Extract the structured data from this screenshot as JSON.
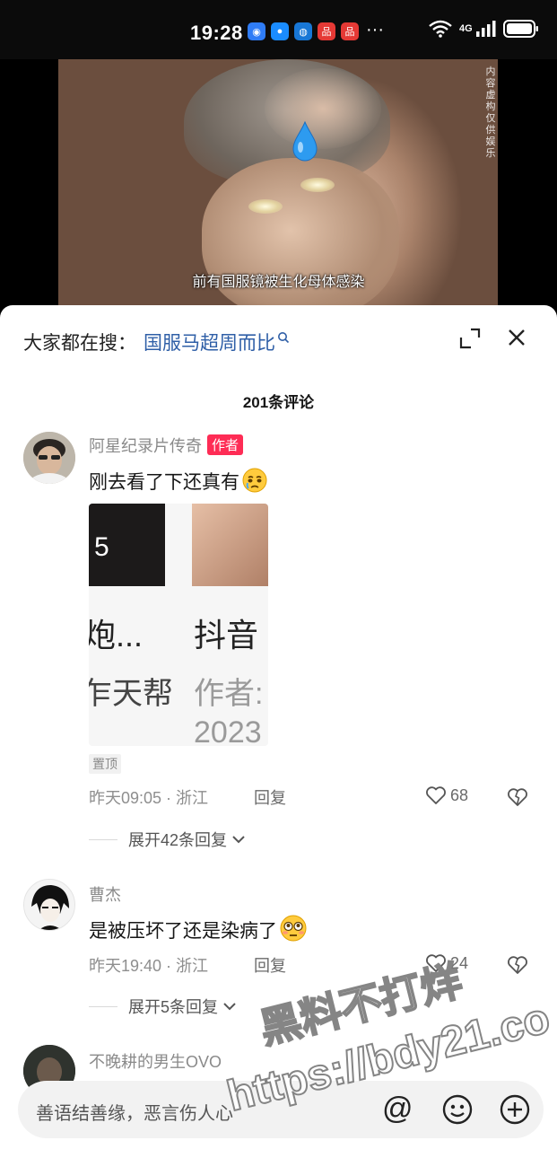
{
  "status_bar": {
    "time": "19:28",
    "more": "···",
    "network": "4G",
    "icons": [
      "wifi-icon",
      "signal-icon",
      "battery-icon"
    ],
    "app_icons": [
      {
        "name": "app-icon-blue-1",
        "color": "#2f7cf6"
      },
      {
        "name": "app-icon-blue-2",
        "color": "#1a8cff"
      },
      {
        "name": "app-icon-blue-3",
        "color": "#1877d6"
      },
      {
        "name": "app-icon-red-1",
        "color": "#e53935"
      },
      {
        "name": "app-icon-red-2",
        "color": "#e53935"
      }
    ]
  },
  "video": {
    "subtitle": "前有国服镜被生化母体感染",
    "side_text": "内容虚构 仅供娱乐"
  },
  "sheet": {
    "search_prefix": "大家都在搜：",
    "search_term": "国服马超周而比",
    "comment_count": "201条评论"
  },
  "comments": [
    {
      "username": "阿星纪录片传奇",
      "author_tag": "作者",
      "text": "刚去看了下还真有",
      "emoji": "crying-face-emoji",
      "image": {
        "t_num": "5",
        "t1": "炮...",
        "t2": "抖音",
        "t3": "乍天帮",
        "t4": "作者:",
        "t5": "2023"
      },
      "pinned": "置顶",
      "time": "昨天09:05",
      "location": "浙江",
      "reply": "回复",
      "likes": "68",
      "expand": "展开42条回复"
    },
    {
      "username": "曹杰",
      "text": "是被压坏了还是染病了",
      "emoji": "flushed-face-emoji",
      "time": "昨天19:40",
      "location": "浙江",
      "reply": "回复",
      "likes": "24",
      "expand": "展开5条回复"
    },
    {
      "username": "不晚耕的男生OVO"
    }
  ],
  "input": {
    "placeholder": "善语结善缘，恶言伤人心",
    "at": "@"
  },
  "watermark": {
    "cn": "黑料不打烊",
    "url": "https://bdy21.co"
  },
  "colors": {
    "accent": "#fe2c55",
    "search_link": "#2f5fa7"
  }
}
